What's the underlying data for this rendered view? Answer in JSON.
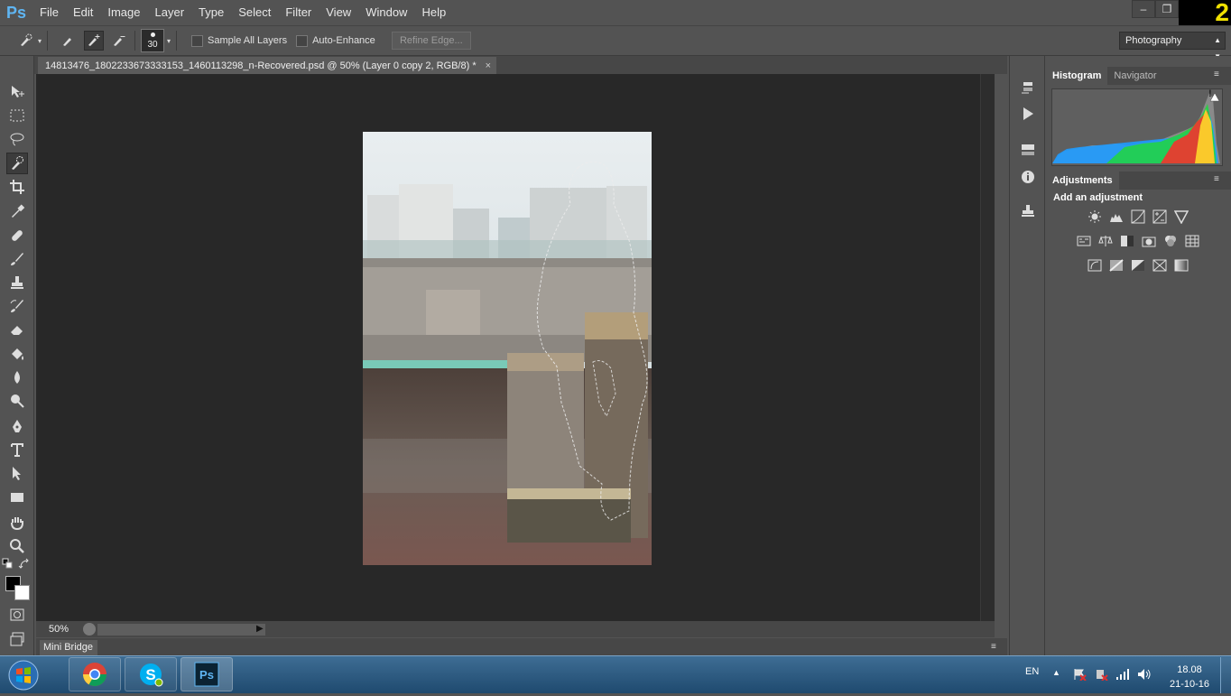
{
  "app": {
    "logo": "Ps",
    "corner_badge": "2"
  },
  "menu": [
    "File",
    "Edit",
    "Image",
    "Layer",
    "Type",
    "Select",
    "Filter",
    "View",
    "Window",
    "Help"
  ],
  "window_controls": {
    "minimize": "–",
    "restore": "❐"
  },
  "options": {
    "brush_size": "30",
    "sample_all_layers": "Sample All Layers",
    "auto_enhance": "Auto-Enhance",
    "refine_edge": "Refine Edge...",
    "workspace": "Photography"
  },
  "document": {
    "tab_title": "14813476_1802233673333153_1460113298_n-Recovered.psd @ 50% (Layer 0 copy 2, RGB/8) *",
    "close": "×",
    "zoom": "50%"
  },
  "mini_bridge": {
    "label": "Mini Bridge"
  },
  "panels": {
    "histogram_tabs": [
      "Histogram",
      "Navigator"
    ],
    "adjustments_tab": "Adjustments",
    "adjustments_title": "Add an adjustment",
    "adjustment_icons": [
      [
        "brightness-icon",
        "levels-icon",
        "curves-icon",
        "exposure-icon",
        "vibrance-icon"
      ],
      [
        "hue-saturation-icon",
        "color-balance-icon",
        "black-white-icon",
        "photo-filter-icon",
        "channel-mixer-icon",
        "color-lookup-icon"
      ],
      [
        "invert-icon",
        "posterize-icon",
        "threshold-icon",
        "selective-color-icon",
        "gradient-map-icon"
      ]
    ]
  },
  "taskbar": {
    "language": "EN",
    "time": "18.08",
    "date": "21-10-16",
    "apps": [
      "chrome-icon",
      "skype-icon",
      "photoshop-icon"
    ]
  },
  "colors": {
    "ui_bg": "#535353",
    "canvas_bg": "#282828",
    "ps_blue": "#5fb5f2",
    "taskbar": "#2c5a80"
  }
}
